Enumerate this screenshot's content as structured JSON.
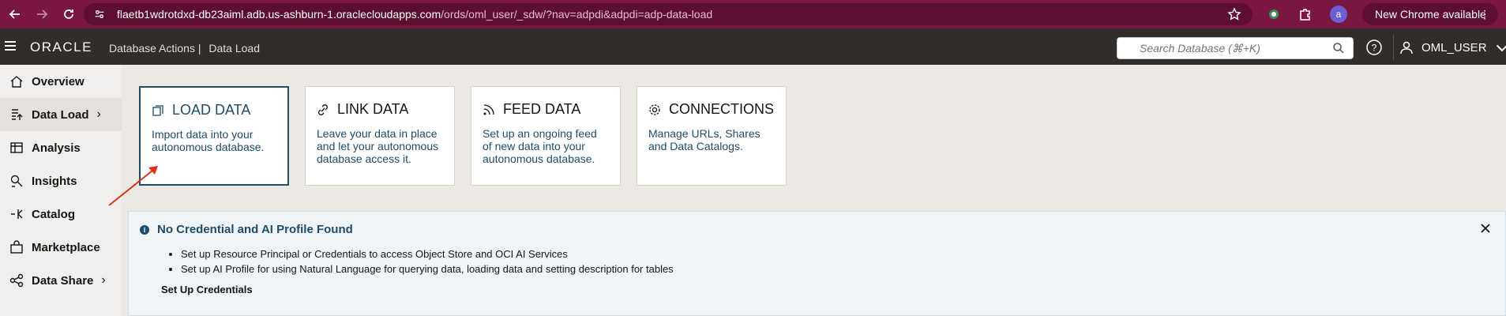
{
  "browser": {
    "url_host": "flaetb1wdrotdxd-db23aiml.adb.us-ashburn-1.oraclecloudapps.com",
    "url_path": "/ords/oml_user/_sdw/?nav=adpdi&adpdi=adp-data-load",
    "update_label": "New Chrome available",
    "profile_initial": "a",
    "accent": "#7a1741"
  },
  "header": {
    "logo": "ORACLE",
    "app_name": "Database Actions",
    "separator": "|",
    "section": "Data Load",
    "search_placeholder": "Search Database (⌘+K)",
    "user": "OML_USER"
  },
  "sidebar": {
    "items": [
      {
        "label": "Overview",
        "icon": "home-icon"
      },
      {
        "label": "Data Load",
        "icon": "data-load-icon",
        "active": true,
        "chevron": true
      },
      {
        "label": "Analysis",
        "icon": "analysis-icon"
      },
      {
        "label": "Insights",
        "icon": "insights-icon"
      },
      {
        "label": "Catalog",
        "icon": "catalog-icon"
      },
      {
        "label": "Marketplace",
        "icon": "marketplace-icon"
      },
      {
        "label": "Data Share",
        "icon": "share-icon",
        "chevron": true
      }
    ]
  },
  "cards": [
    {
      "title": "LOAD DATA",
      "desc": "Import data into your autonomous database.",
      "icon": "load-icon",
      "selected": true
    },
    {
      "title": "LINK DATA",
      "desc": "Leave your data in place and let your autonomous database access it.",
      "icon": "link-icon"
    },
    {
      "title": "FEED DATA",
      "desc": "Set up an ongoing feed of new data into your autonomous database.",
      "icon": "feed-icon"
    },
    {
      "title": "CONNECTIONS",
      "desc": "Manage URLs, Shares and Data Catalogs.",
      "icon": "gear-icon"
    }
  ],
  "banner": {
    "title": "No Credential and AI Profile Found",
    "items": [
      "Set up Resource Principal or Credentials to access Object Store and OCI AI Services",
      "Set up AI Profile for using Natural Language for querying data, loading data and setting description for tables"
    ],
    "link": "Set Up Credentials"
  }
}
